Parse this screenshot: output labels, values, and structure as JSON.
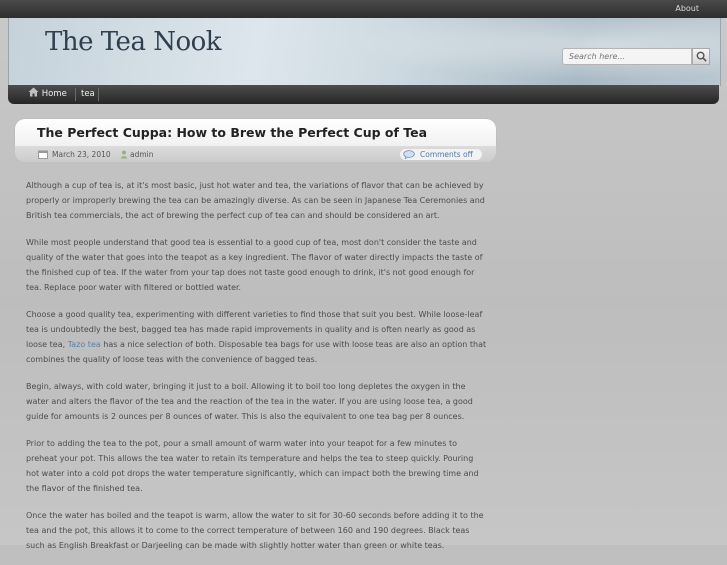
{
  "topbar": {
    "about_label": "About"
  },
  "header": {
    "site_title": "The Tea Nook",
    "search_placeholder": "Search here..."
  },
  "nav": {
    "items": [
      "Home",
      "tea"
    ]
  },
  "post": {
    "title": "The Perfect Cuppa: How to Brew the Perfect Cup of Tea",
    "date": "March 23, 2010",
    "author": "admin",
    "comments": "Comments off",
    "paragraphs": [
      "Although a cup of tea is, at it's most basic, just hot water and tea, the variations of flavor that can be achieved by properly or improperly brewing the tea can be amazingly diverse. As can be seen in Japanese Tea Ceremonies and British tea commercials, the act of brewing the perfect cup of tea can and should be considered an art.",
      "While most people understand that good tea is essential to a good cup of tea, most don't consider the taste and quality of the water that goes into the teapot as a key ingredient. The flavor of water directly impacts the taste of the finished cup of tea. If the water from your tap does not taste good enough to drink, it's not good enough for tea. Replace poor water with filtered or bottled water.",
      {
        "before": "Choose a good quality tea, experimenting with different varieties to find those that suit you best. While loose-leaf tea is undoubtedly the best, bagged tea has made rapid improvements in quality and is often nearly as good as loose tea, ",
        "link": "Tazo tea",
        "after": " has a nice selection of both.  Disposable tea bags for use with loose teas are also an option that combines the quality of loose teas with the convenience of bagged teas."
      },
      "Begin, always, with cold water, bringing it just to a boil. Allowing it to boil too long depletes the oxygen in the water and alters the flavor of the tea and the reaction of the tea in the water. If you are using loose tea, a good guide for amounts is 2 ounces per 8 ounces of water. This is also the equivalent to one tea bag per 8 ounces.",
      "Prior to adding the tea to the pot, pour a small amount of warm water into your teapot for a few minutes to preheat your pot. This allows the tea water to retain its temperature and helps the tea to steep quickly. Pouring hot water into a cold pot drops the water temperature significantly, which can impact both the brewing time and the flavor of the finished tea.",
      "Once the water has boiled and the teapot is warm, allow the water to sit for 30-60 seconds before adding it to the tea and the pot, this allows it to come to the correct temperature of between 160 and 190 degrees. Black teas such as English Breakfast or Darjeeling can be made with slightly hotter water than green or white teas."
    ]
  },
  "icons": {
    "home": "home-icon",
    "search": "search-icon",
    "calendar": "calendar-icon",
    "user": "user-icon",
    "comment": "comment-icon"
  },
  "colors": {
    "link": "#5a7ea8",
    "nav_bg": "#2e2e2e",
    "title": "#2f3f4f"
  }
}
